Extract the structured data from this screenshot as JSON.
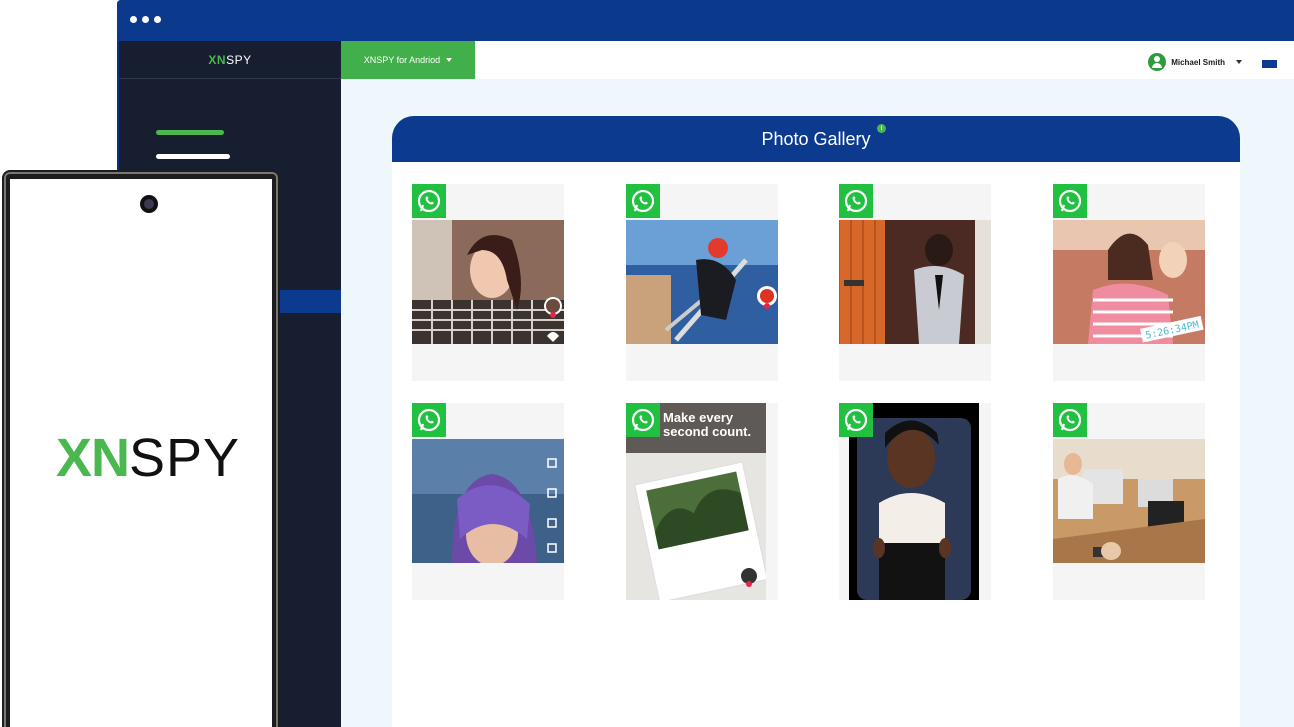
{
  "app": {
    "logo_brand": "XN",
    "logo_suffix": "SPY"
  },
  "topbar": {
    "device_select": "XNSPY for Andriod",
    "user_name": "Michael Smith"
  },
  "gallery": {
    "title": "Photo Gallery",
    "info_icon": "i",
    "items": [
      {
        "source": "whatsapp-icon"
      },
      {
        "source": "whatsapp-icon"
      },
      {
        "source": "whatsapp-icon"
      },
      {
        "source": "whatsapp-icon",
        "overlay_time": "5:26:34PM"
      },
      {
        "source": "whatsapp-icon"
      },
      {
        "source": "whatsapp-icon",
        "overlay_text": "Make every second count."
      },
      {
        "source": "whatsapp-icon"
      },
      {
        "source": "whatsapp-icon"
      }
    ]
  },
  "phone": {
    "logo_brand": "XN",
    "logo_suffix": "SPY"
  },
  "colors": {
    "brand_green": "#4ab84f",
    "navy": "#0c3a8f",
    "sidebar": "#161e30",
    "whatsapp": "#21c041"
  }
}
